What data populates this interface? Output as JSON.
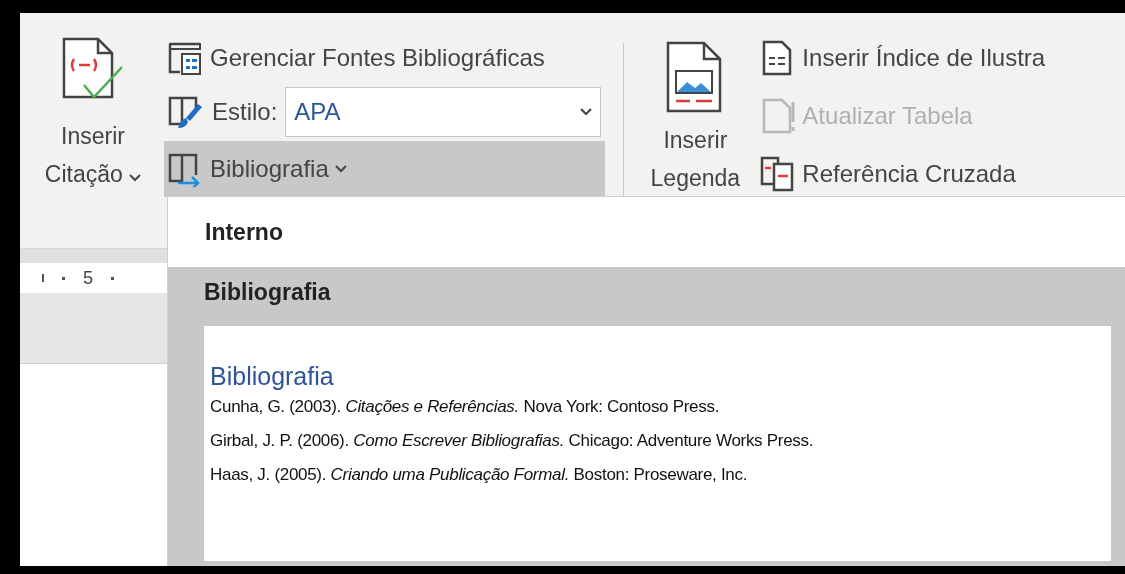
{
  "ribbon": {
    "citations_group": {
      "insert_citation": {
        "lines": [
          "Inserir",
          "Citação"
        ]
      },
      "manage_sources": {
        "label": "Gerenciar Fontes Bibliográficas"
      },
      "style": {
        "label": "Estilo:",
        "value": "APA"
      },
      "bibliography": {
        "label": "Bibliografia",
        "selected": true
      }
    },
    "captions_group": {
      "insert_caption": {
        "lines": [
          "Inserir",
          "Legenda"
        ]
      },
      "items": [
        {
          "kind": "figures-index",
          "label": "Inserir Índice de Ilustra",
          "disabled": false
        },
        {
          "kind": "update-table",
          "label": "Atualizar Tabela",
          "disabled": true
        },
        {
          "kind": "cross-reference",
          "label": "Referência Cruzada",
          "disabled": false
        }
      ]
    }
  },
  "ruler": {
    "label": "5"
  },
  "menu": {
    "section_header": "Interno",
    "items": [
      {
        "label": "Bibliografia",
        "selected": true,
        "preview": {
          "heading": "Bibliografia",
          "entries": [
            "Cunha, G. (2003). *Citações e Referências.* Nova York: Contoso Press.",
            "Girbal, J. P. (2006). *Como Escrever Bibliografias.* Chicago: Adventure Works Press.",
            "Haas, J. (2005). *Criando uma Publicação Formal.* Boston: Proseware, Inc."
          ]
        }
      }
    ]
  }
}
